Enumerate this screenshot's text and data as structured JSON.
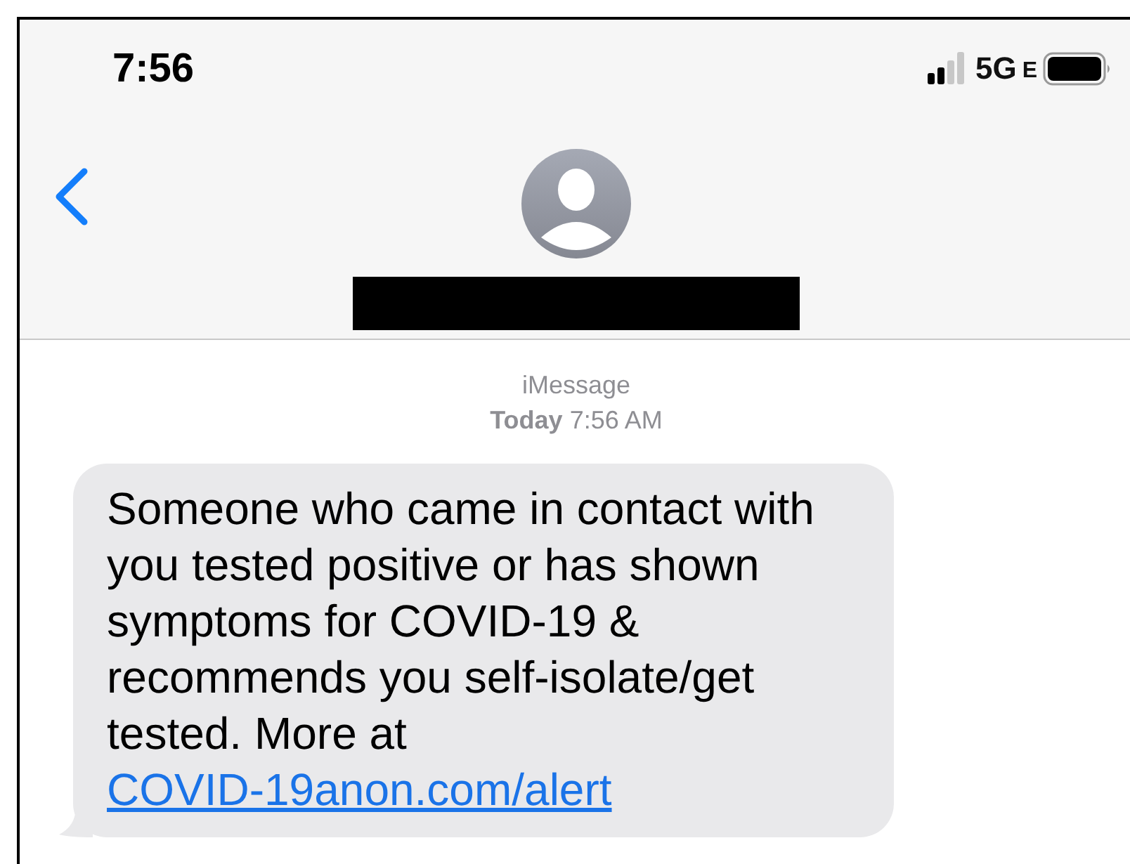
{
  "status_bar": {
    "time": "7:56",
    "network": "5G",
    "network_suffix": "E"
  },
  "conversation": {
    "service": "iMessage",
    "timestamp": "**Today** 7:56 AM",
    "messages": [
      {
        "text": "Someone who came in contact with you tested positive or has shown symptoms for COVID-19 & recommends you self-isolate/get tested. More at",
        "link": "COVID-19anon.com/alert"
      }
    ]
  }
}
